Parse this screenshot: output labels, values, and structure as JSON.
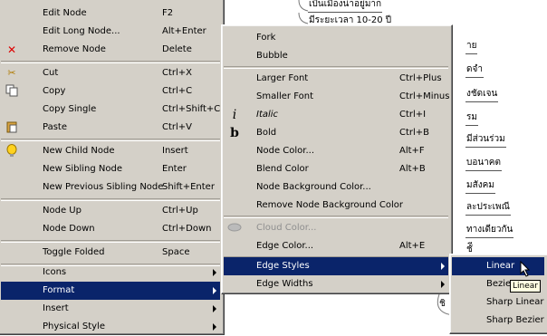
{
  "background": {
    "nodes": [
      "เป็นเมืองน่าอยู่มาก",
      "มีระยะเวลา 10-20 ปี",
      "าย",
      "ดจำ",
      "งชัดเจน",
      "รม",
      "มีส่วนร่วม",
      "บอนาคต",
      "มสังคม",
      "ละประเพณี",
      "ทางเดียวกัน",
      "ชัี",
      "ชิ"
    ]
  },
  "main_menu": {
    "items": [
      {
        "label": "Edit Node",
        "shortcut": "F2",
        "icon": ""
      },
      {
        "label": "Edit Long Node...",
        "shortcut": "Alt+Enter",
        "icon": ""
      },
      {
        "label": "Remove Node",
        "shortcut": "Delete",
        "icon": "remove-icon"
      },
      {
        "label": "Cut",
        "shortcut": "Ctrl+X",
        "icon": "cut-icon"
      },
      {
        "label": "Copy",
        "shortcut": "Ctrl+C",
        "icon": "copy-icon"
      },
      {
        "label": "Copy Single",
        "shortcut": "Ctrl+Shift+C",
        "icon": ""
      },
      {
        "label": "Paste",
        "shortcut": "Ctrl+V",
        "icon": "paste-icon"
      },
      {
        "label": "New Child Node",
        "shortcut": "Insert",
        "icon": "lightbulb-icon"
      },
      {
        "label": "New Sibling Node",
        "shortcut": "Enter",
        "icon": ""
      },
      {
        "label": "New Previous Sibling Node",
        "shortcut": "Shift+Enter",
        "icon": ""
      },
      {
        "label": "Node Up",
        "shortcut": "Ctrl+Up",
        "icon": ""
      },
      {
        "label": "Node Down",
        "shortcut": "Ctrl+Down",
        "icon": ""
      },
      {
        "label": "Toggle Folded",
        "shortcut": "Space",
        "icon": ""
      },
      {
        "label": "Icons",
        "shortcut": "",
        "icon": ""
      },
      {
        "label": "Format",
        "shortcut": "",
        "icon": ""
      },
      {
        "label": "Insert",
        "shortcut": "",
        "icon": ""
      },
      {
        "label": "Physical Style",
        "shortcut": "",
        "icon": ""
      }
    ]
  },
  "format_menu": {
    "items": [
      {
        "label": "Fork",
        "shortcut": ""
      },
      {
        "label": "Bubble",
        "shortcut": ""
      },
      {
        "label": "Larger Font",
        "shortcut": "Ctrl+Plus"
      },
      {
        "label": "Smaller Font",
        "shortcut": "Ctrl+Minus"
      },
      {
        "label": "Italic",
        "shortcut": "Ctrl+I",
        "icon_glyph": "i"
      },
      {
        "label": "Bold",
        "shortcut": "Ctrl+B",
        "icon_glyph": "b"
      },
      {
        "label": "Node Color...",
        "shortcut": "Alt+F"
      },
      {
        "label": "Blend Color",
        "shortcut": "Alt+B"
      },
      {
        "label": "Node Background Color...",
        "shortcut": ""
      },
      {
        "label": "Remove Node Background Color",
        "shortcut": ""
      },
      {
        "label": "Cloud Color...",
        "shortcut": ""
      },
      {
        "label": "Edge Color...",
        "shortcut": "Alt+E"
      },
      {
        "label": "Edge Styles",
        "shortcut": ""
      },
      {
        "label": "Edge Widths",
        "shortcut": ""
      }
    ]
  },
  "edge_styles_menu": {
    "items": [
      {
        "label": "Linear"
      },
      {
        "label": "Bezier"
      },
      {
        "label": "Sharp Linear"
      },
      {
        "label": "Sharp Bezier"
      }
    ]
  },
  "tooltip": {
    "text": "Linear"
  },
  "colors": {
    "menu_bg": "#d4d0c8",
    "selection": "#0a246a",
    "tooltip_bg": "#ffffe1"
  }
}
